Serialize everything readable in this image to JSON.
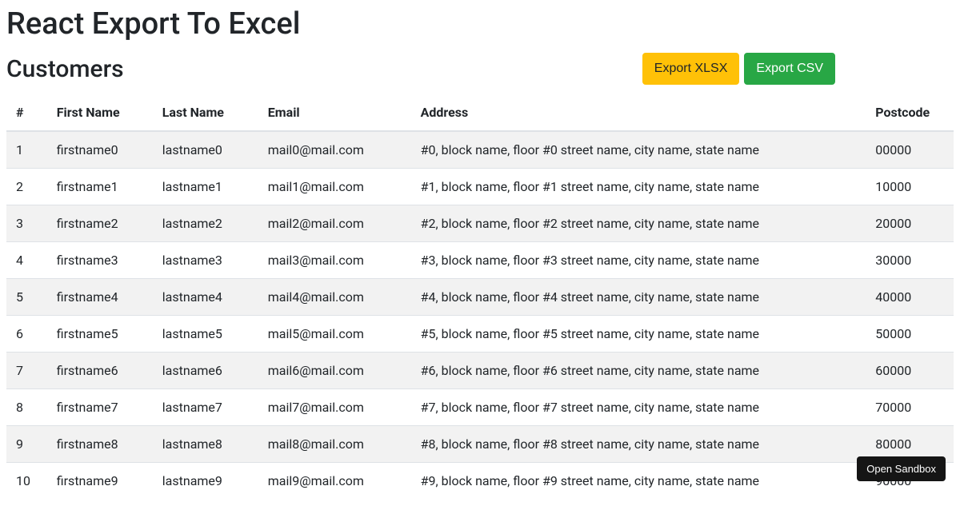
{
  "page_title": "React Export To Excel",
  "section_title": "Customers",
  "buttons": {
    "export_xlsx": "Export XLSX",
    "export_csv": "Export CSV",
    "open_sandbox": "Open Sandbox"
  },
  "table": {
    "headers": {
      "index": "#",
      "first_name": "First Name",
      "last_name": "Last Name",
      "email": "Email",
      "address": "Address",
      "postcode": "Postcode"
    },
    "rows": [
      {
        "index": "1",
        "first_name": "firstname0",
        "last_name": "lastname0",
        "email": "mail0@mail.com",
        "address": "#0, block name, floor #0 street name, city name, state name",
        "postcode": "00000"
      },
      {
        "index": "2",
        "first_name": "firstname1",
        "last_name": "lastname1",
        "email": "mail1@mail.com",
        "address": "#1, block name, floor #1 street name, city name, state name",
        "postcode": "10000"
      },
      {
        "index": "3",
        "first_name": "firstname2",
        "last_name": "lastname2",
        "email": "mail2@mail.com",
        "address": "#2, block name, floor #2 street name, city name, state name",
        "postcode": "20000"
      },
      {
        "index": "4",
        "first_name": "firstname3",
        "last_name": "lastname3",
        "email": "mail3@mail.com",
        "address": "#3, block name, floor #3 street name, city name, state name",
        "postcode": "30000"
      },
      {
        "index": "5",
        "first_name": "firstname4",
        "last_name": "lastname4",
        "email": "mail4@mail.com",
        "address": "#4, block name, floor #4 street name, city name, state name",
        "postcode": "40000"
      },
      {
        "index": "6",
        "first_name": "firstname5",
        "last_name": "lastname5",
        "email": "mail5@mail.com",
        "address": "#5, block name, floor #5 street name, city name, state name",
        "postcode": "50000"
      },
      {
        "index": "7",
        "first_name": "firstname6",
        "last_name": "lastname6",
        "email": "mail6@mail.com",
        "address": "#6, block name, floor #6 street name, city name, state name",
        "postcode": "60000"
      },
      {
        "index": "8",
        "first_name": "firstname7",
        "last_name": "lastname7",
        "email": "mail7@mail.com",
        "address": "#7, block name, floor #7 street name, city name, state name",
        "postcode": "70000"
      },
      {
        "index": "9",
        "first_name": "firstname8",
        "last_name": "lastname8",
        "email": "mail8@mail.com",
        "address": "#8, block name, floor #8 street name, city name, state name",
        "postcode": "80000"
      },
      {
        "index": "10",
        "first_name": "firstname9",
        "last_name": "lastname9",
        "email": "mail9@mail.com",
        "address": "#9, block name, floor #9 street name, city name, state name",
        "postcode": "90000"
      }
    ]
  }
}
